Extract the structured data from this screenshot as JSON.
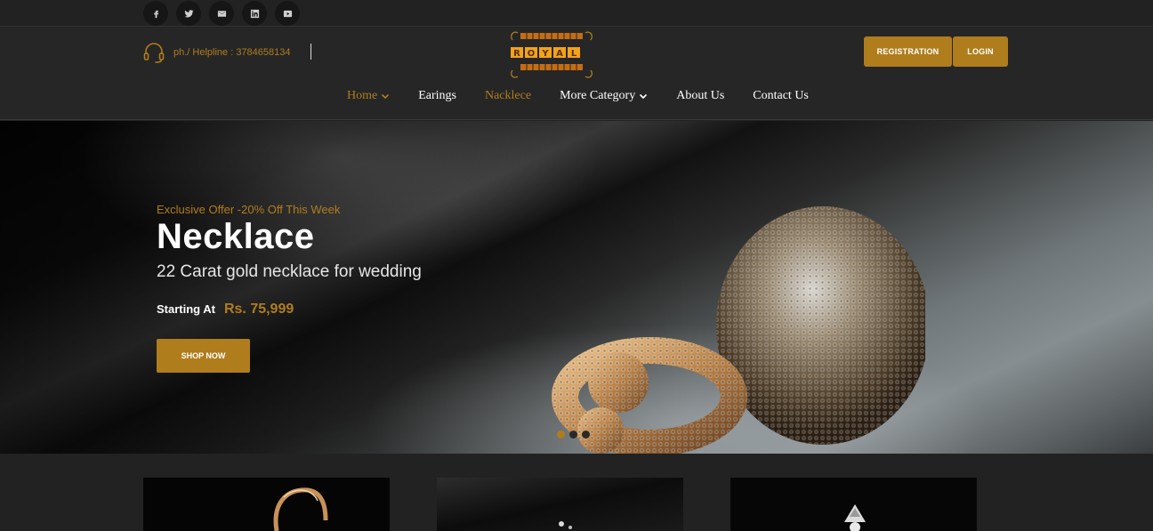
{
  "social": {
    "items": [
      {
        "name": "facebook-icon",
        "glyph": "f"
      },
      {
        "name": "twitter-icon",
        "glyph": "t"
      },
      {
        "name": "email-icon",
        "glyph": "m"
      },
      {
        "name": "linkedin-icon",
        "glyph": "in"
      },
      {
        "name": "youtube-icon",
        "glyph": "yt"
      }
    ]
  },
  "header": {
    "helpline": "ph./ Helpline : 3784658134",
    "logo_text": "ROYAL",
    "registration_label": "REGISTRATION",
    "login_label": "LOGIN"
  },
  "nav": {
    "items": [
      {
        "label": "Home",
        "active": true,
        "dropdown": true
      },
      {
        "label": "Earings",
        "active": false,
        "dropdown": false
      },
      {
        "label": "Nacklece",
        "active": false,
        "hovered": true,
        "dropdown": false
      },
      {
        "label": "More Category",
        "active": false,
        "dropdown": true
      },
      {
        "label": "About Us",
        "active": false,
        "dropdown": false
      },
      {
        "label": "Contact Us",
        "active": false,
        "dropdown": false
      }
    ]
  },
  "hero": {
    "offer": "Exclusive Offer -20% Off This Week",
    "title": "Necklace",
    "subtitle": "22 Carat gold necklace for wedding",
    "starting_label": "Starting At",
    "price": "Rs. 75,999",
    "button_label": "SHOP NOW",
    "slides": 3,
    "active_slide": 1
  },
  "colors": {
    "accent": "#b07d1d",
    "background": "#222222",
    "header": "#262626"
  }
}
